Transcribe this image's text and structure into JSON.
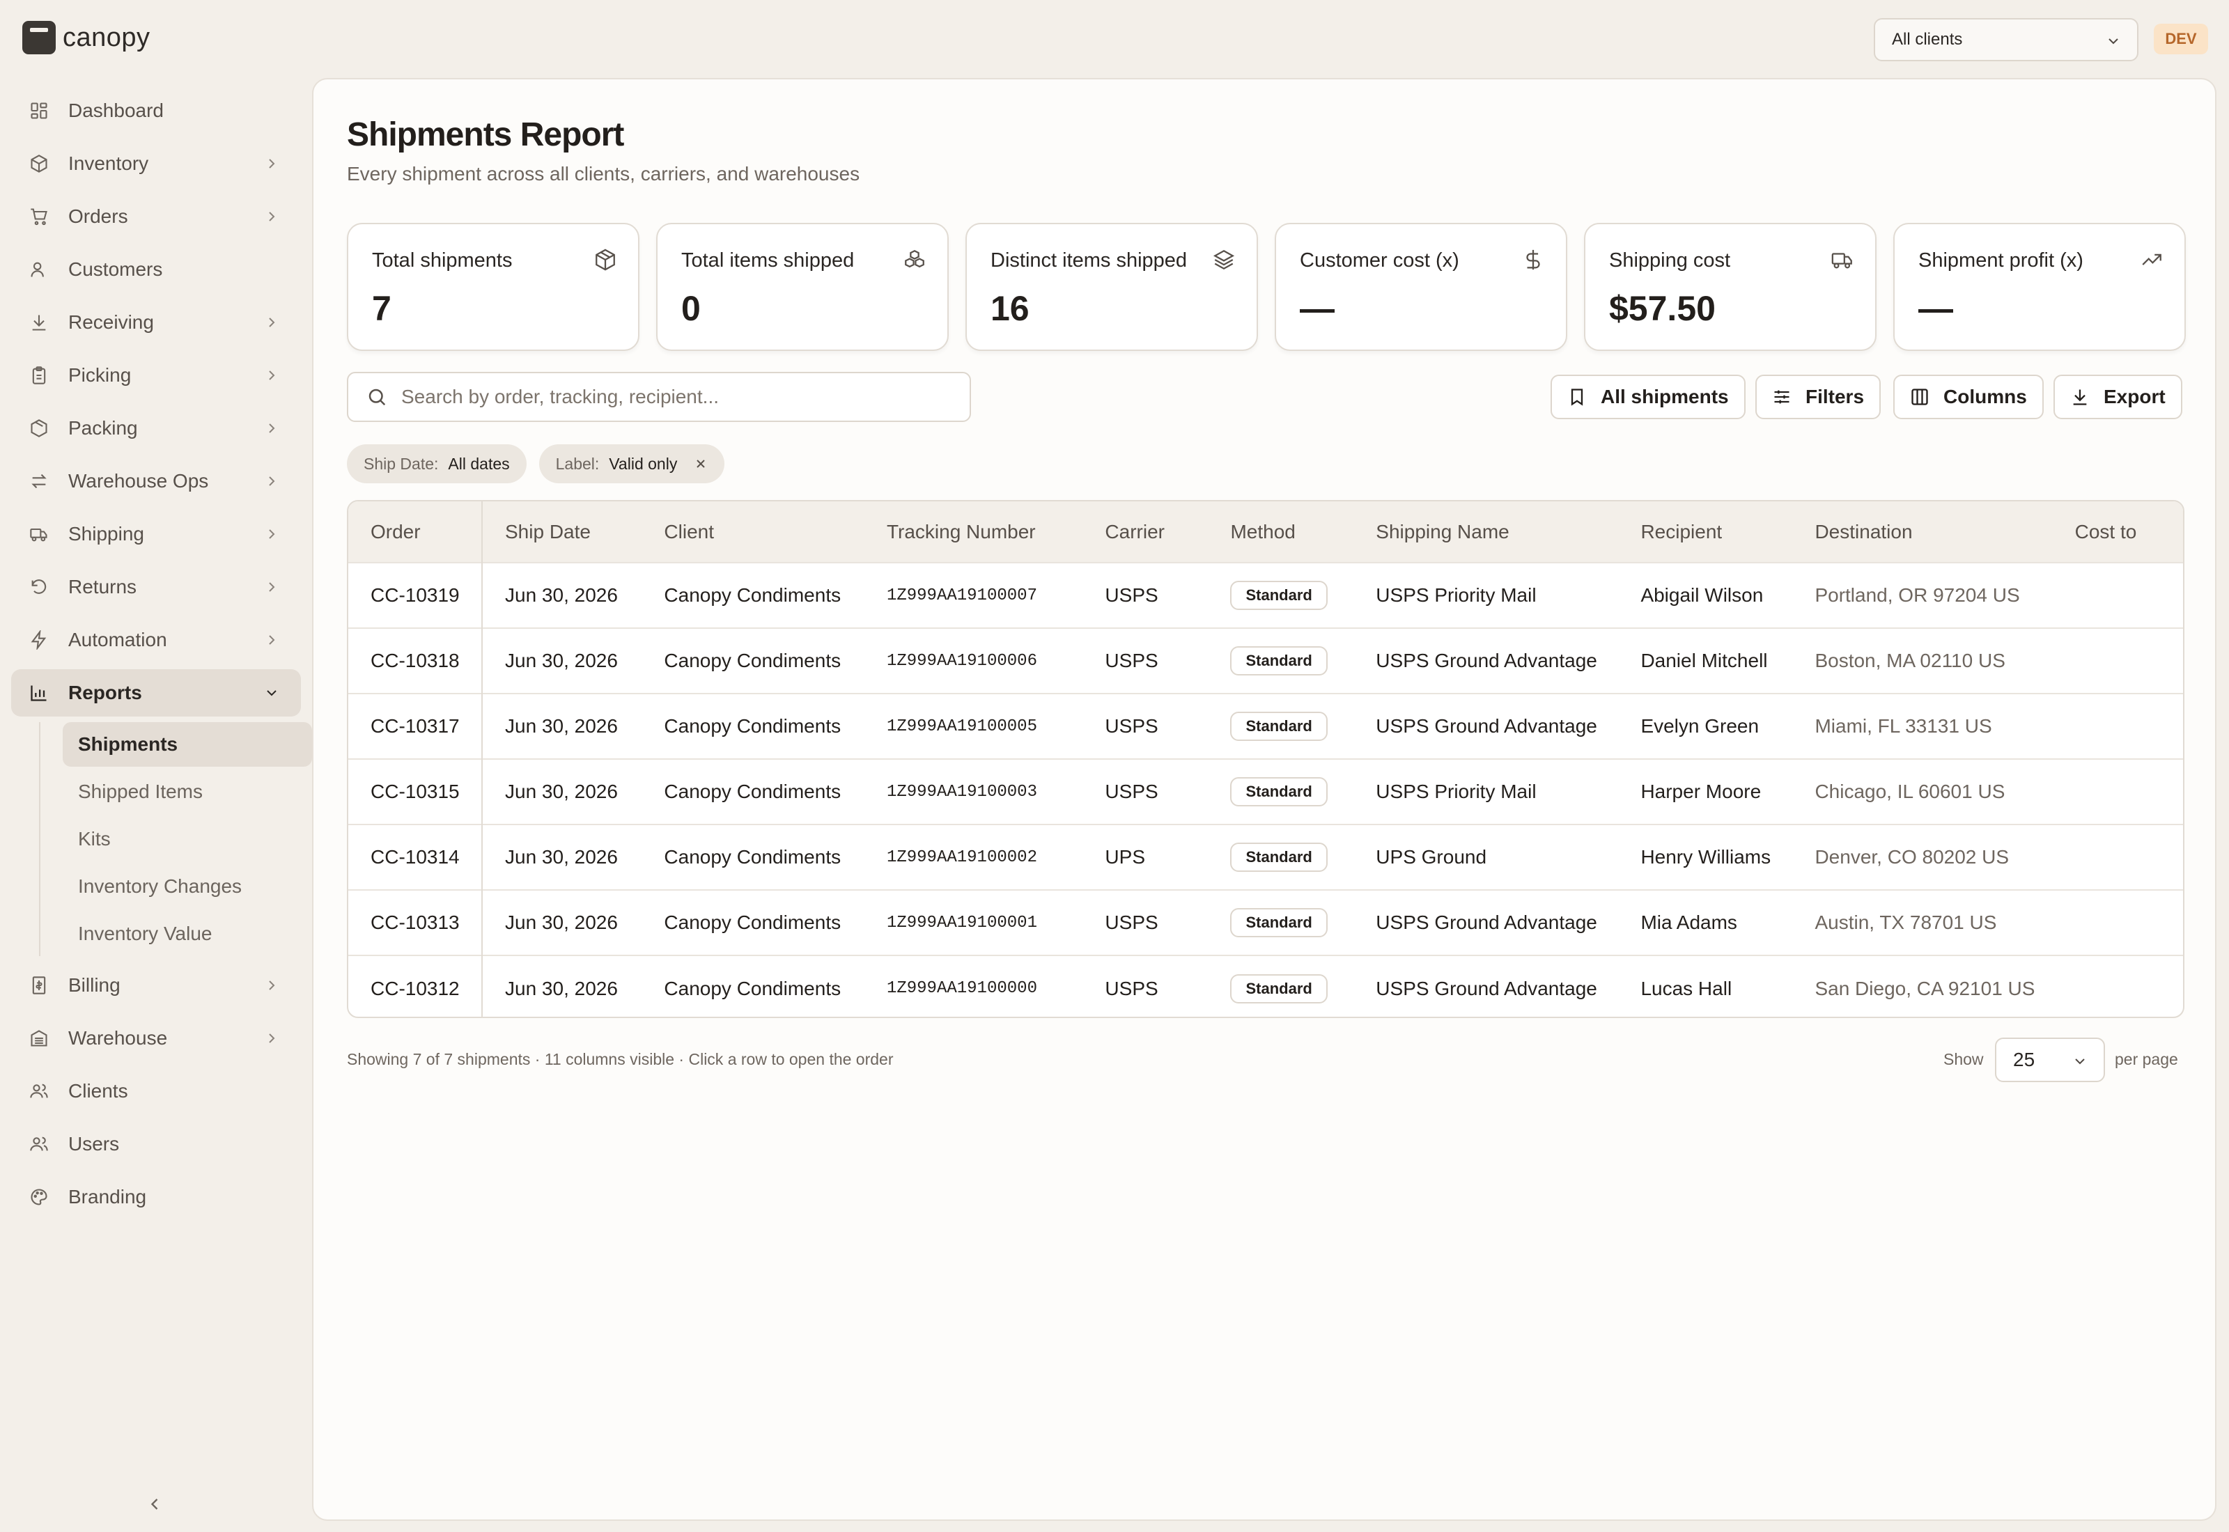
{
  "app": {
    "name": "canopy",
    "env_badge": "DEV"
  },
  "client_select": {
    "value": "All clients"
  },
  "sidebar": {
    "items": [
      {
        "label": "Dashboard",
        "icon": "dashboard-icon",
        "has_children": false
      },
      {
        "label": "Inventory",
        "icon": "box-icon",
        "has_children": true
      },
      {
        "label": "Orders",
        "icon": "cart-icon",
        "has_children": true
      },
      {
        "label": "Customers",
        "icon": "user-icon",
        "has_children": false
      },
      {
        "label": "Receiving",
        "icon": "download-icon",
        "has_children": true
      },
      {
        "label": "Picking",
        "icon": "clipboard-icon",
        "has_children": true
      },
      {
        "label": "Packing",
        "icon": "package-icon",
        "has_children": true
      },
      {
        "label": "Warehouse Ops",
        "icon": "arrows-icon",
        "has_children": true
      },
      {
        "label": "Shipping",
        "icon": "truck-icon",
        "has_children": true
      },
      {
        "label": "Returns",
        "icon": "undo-icon",
        "has_children": true
      },
      {
        "label": "Automation",
        "icon": "bolt-icon",
        "has_children": true
      },
      {
        "label": "Reports",
        "icon": "bar-chart-icon",
        "has_children": true,
        "expanded": true
      }
    ],
    "report_subitems": [
      {
        "label": "Shipments",
        "active": true
      },
      {
        "label": "Shipped Items"
      },
      {
        "label": "Kits"
      },
      {
        "label": "Inventory Changes"
      },
      {
        "label": "Inventory Value"
      }
    ],
    "items_after": [
      {
        "label": "Billing",
        "icon": "receipt-icon",
        "has_children": true
      },
      {
        "label": "Warehouse",
        "icon": "building-icon",
        "has_children": true
      },
      {
        "label": "Clients",
        "icon": "users-icon",
        "has_children": false
      },
      {
        "label": "Users",
        "icon": "users-icon",
        "has_children": false
      },
      {
        "label": "Branding",
        "icon": "palette-icon",
        "has_children": false
      }
    ]
  },
  "page": {
    "title": "Shipments Report",
    "subtitle": "Every shipment across all clients, carriers, and warehouses"
  },
  "cards": [
    {
      "label": "Total shipments",
      "value": "7",
      "icon": "package-icon"
    },
    {
      "label": "Total items shipped",
      "value": "0",
      "icon": "boxes-icon"
    },
    {
      "label": "Distinct items shipped",
      "value": "16",
      "icon": "layers-icon"
    },
    {
      "label": "Customer cost (x)",
      "value": "—",
      "icon": "dollar-icon"
    },
    {
      "label": "Shipping cost",
      "value": "$57.50",
      "icon": "truck-icon"
    },
    {
      "label": "Shipment profit (x)",
      "value": "—",
      "icon": "trending-up-icon"
    }
  ],
  "search": {
    "placeholder": "Search by order, tracking, recipient..."
  },
  "toolbar": {
    "saved_view": "All shipments",
    "filters": "Filters",
    "columns": "Columns",
    "export": "Export"
  },
  "chips": [
    {
      "key": "Ship Date:",
      "value": "All dates"
    },
    {
      "key": "Label:",
      "value": "Valid only",
      "removable": true
    }
  ],
  "table": {
    "headers": [
      "Order",
      "Ship Date",
      "Client",
      "Tracking Number",
      "Carrier",
      "Method",
      "Shipping Name",
      "Recipient",
      "Destination",
      "Cost to"
    ],
    "rows": [
      [
        "CC-10319",
        "Jun 30, 2026",
        "Canopy Condiments",
        "1Z999AA19100007",
        "USPS",
        "Standard",
        "USPS Priority Mail",
        "Abigail Wilson",
        "Portland, OR 97204 US",
        ""
      ],
      [
        "CC-10318",
        "Jun 30, 2026",
        "Canopy Condiments",
        "1Z999AA19100006",
        "USPS",
        "Standard",
        "USPS Ground Advantage",
        "Daniel Mitchell",
        "Boston, MA 02110 US",
        ""
      ],
      [
        "CC-10317",
        "Jun 30, 2026",
        "Canopy Condiments",
        "1Z999AA19100005",
        "USPS",
        "Standard",
        "USPS Ground Advantage",
        "Evelyn Green",
        "Miami, FL 33131 US",
        ""
      ],
      [
        "CC-10315",
        "Jun 30, 2026",
        "Canopy Condiments",
        "1Z999AA19100003",
        "USPS",
        "Standard",
        "USPS Priority Mail",
        "Harper Moore",
        "Chicago, IL 60601 US",
        ""
      ],
      [
        "CC-10314",
        "Jun 30, 2026",
        "Canopy Condiments",
        "1Z999AA19100002",
        "UPS",
        "Standard",
        "UPS Ground",
        "Henry Williams",
        "Denver, CO 80202 US",
        ""
      ],
      [
        "CC-10313",
        "Jun 30, 2026",
        "Canopy Condiments",
        "1Z999AA19100001",
        "USPS",
        "Standard",
        "USPS Ground Advantage",
        "Mia Adams",
        "Austin, TX 78701 US",
        ""
      ],
      [
        "CC-10312",
        "Jun 30, 2026",
        "Canopy Condiments",
        "1Z999AA19100000",
        "USPS",
        "Standard",
        "USPS Ground Advantage",
        "Lucas Hall",
        "San Diego, CA 92101 US",
        ""
      ]
    ]
  },
  "footer": {
    "summary": "Showing 7 of 7 shipments · 11 columns visible · Click a row to open the order",
    "show_label": "Show",
    "per_page_value": "25",
    "per_page_label": "per page"
  }
}
